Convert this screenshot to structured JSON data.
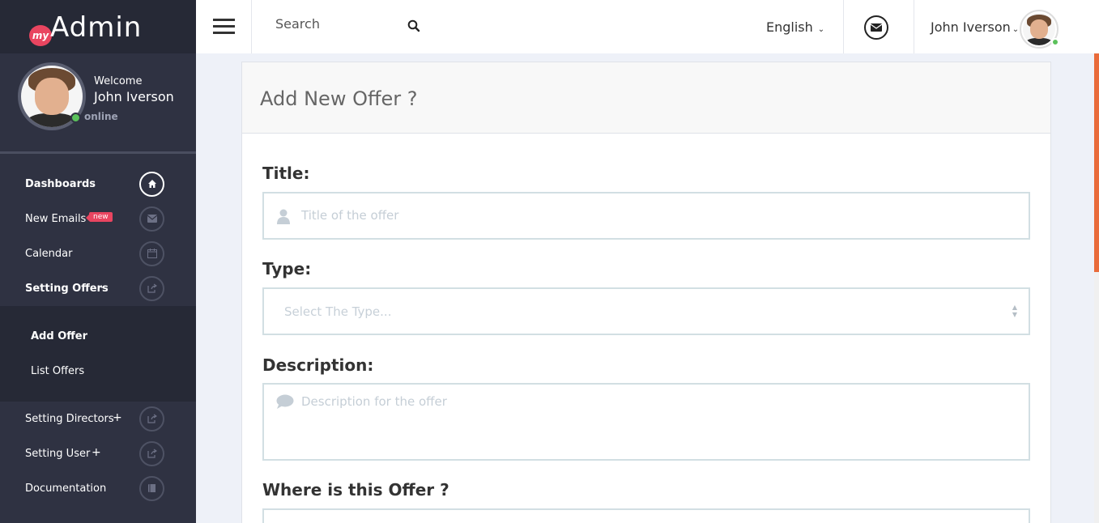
{
  "brand": {
    "badge": "my",
    "name": "Admin"
  },
  "profile": {
    "welcome": "Welcome",
    "name": "John Iverson",
    "status": "online",
    "status_color": "#5bc15b"
  },
  "nav": {
    "dashboards": "Dashboards",
    "new_emails": "New Emails",
    "new_badge": "new",
    "calendar": "Calendar",
    "setting_offers": "Setting Offers",
    "setting_offers_sign": "-",
    "add_offer": "Add Offer",
    "list_offers": "List Offers",
    "setting_directors": "Setting Directors",
    "setting_directors_sign": "+",
    "setting_user": "Setting User",
    "setting_user_sign": "+",
    "documentation": "Documentation"
  },
  "header": {
    "search_placeholder": "Search",
    "language": "English",
    "user_name": "John Iverson"
  },
  "form": {
    "panel_title": "Add New Offer ?",
    "title_label": "Title:",
    "title_placeholder": "Title of the offer",
    "type_label": "Type:",
    "type_placeholder": "Select The Type...",
    "description_label": "Description:",
    "description_placeholder": "Description for the offer",
    "where_label": "Where is this Offer ?"
  },
  "colors": {
    "accent": "#e94560",
    "sidebar": "#2f3242",
    "scroll_thumb": "#e96b3a"
  },
  "icons": [
    "home-icon",
    "envelope-icon",
    "calendar-icon",
    "share-icon",
    "book-icon",
    "search-icon",
    "mail-icon",
    "user-icon",
    "comment-icon"
  ]
}
